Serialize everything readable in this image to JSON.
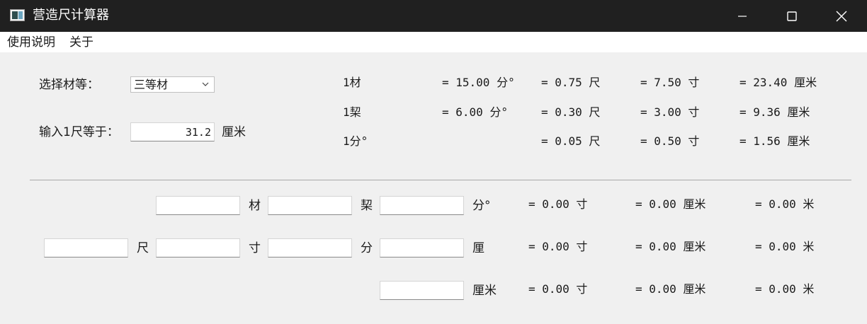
{
  "window": {
    "title": "营造尺计算器"
  },
  "menu": {
    "items": [
      "使用说明",
      "关于"
    ]
  },
  "settings": {
    "grade_label": "选择材等：",
    "grade_value": "三等材",
    "chi_label": "输入1尺等于：",
    "chi_value": "31.2",
    "chi_unit": "厘米"
  },
  "reference": {
    "rows": [
      {
        "name": "1材",
        "fen": "= 15.00 分°",
        "chi": "= 0.75 尺",
        "cun": "= 7.50 寸",
        "cm": "= 23.40 厘米"
      },
      {
        "name": "1栔",
        "fen": "= 6.00 分°",
        "chi": "= 0.30 尺",
        "cun": "= 3.00 寸",
        "cm": "= 9.36 厘米"
      },
      {
        "name": "1分°",
        "fen": "",
        "chi": "= 0.05 尺",
        "cun": "= 0.50 寸",
        "cm": "= 1.56 厘米"
      }
    ]
  },
  "calc": {
    "row1": {
      "units": [
        "材",
        "栔",
        "分°"
      ],
      "result_cun": "= 0.00 寸",
      "result_cm": "= 0.00 厘米",
      "result_m": "= 0.00 米"
    },
    "row2": {
      "units": [
        "尺",
        "寸",
        "分",
        "厘"
      ],
      "result_cun": "= 0.00 寸",
      "result_cm": "= 0.00 厘米",
      "result_m": "= 0.00 米"
    },
    "row3": {
      "units": [
        "厘米"
      ],
      "result_cun": "= 0.00 寸",
      "result_cm": "= 0.00 厘米",
      "result_m": "= 0.00 米"
    }
  },
  "colors": {
    "titlebar": "#202020",
    "window_bg": "#f0f0f0",
    "menubar": "#ffffff"
  }
}
